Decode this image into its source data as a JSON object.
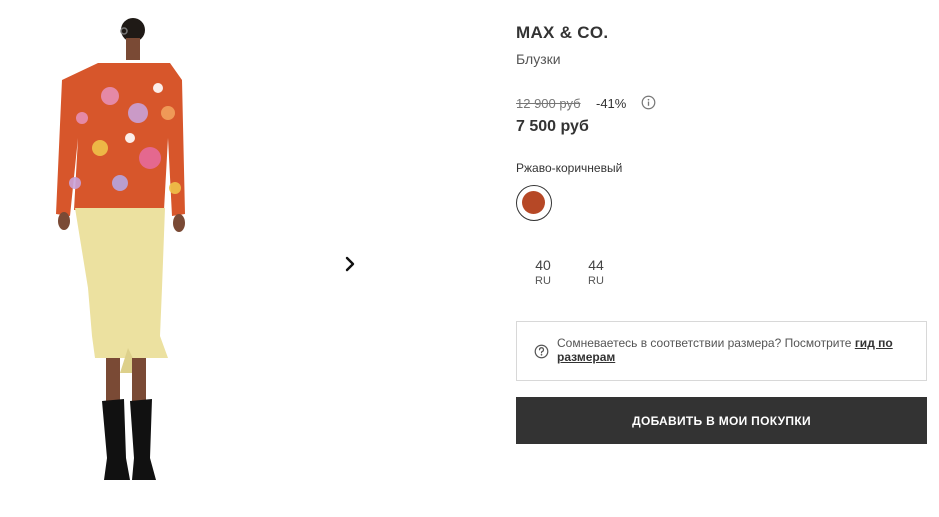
{
  "product": {
    "brand": "MAX & CO.",
    "category": "Блузки",
    "old_price": "12 900 руб",
    "discount": "-41%",
    "price": "7 500 руб",
    "color_name": "Ржаво-коричневый",
    "color_hex": "#b64826"
  },
  "gallery": {
    "next_icon": "chevron-right-icon"
  },
  "sizes": [
    {
      "value": "40",
      "unit": "RU"
    },
    {
      "value": "44",
      "unit": "RU"
    }
  ],
  "size_help": {
    "text": "Сомневаетесь в соответствии размера? Посмотрите ",
    "link": "гид по размерам"
  },
  "cta": {
    "add_label": "ДОБАВИТЬ В МОИ ПОКУПКИ"
  }
}
